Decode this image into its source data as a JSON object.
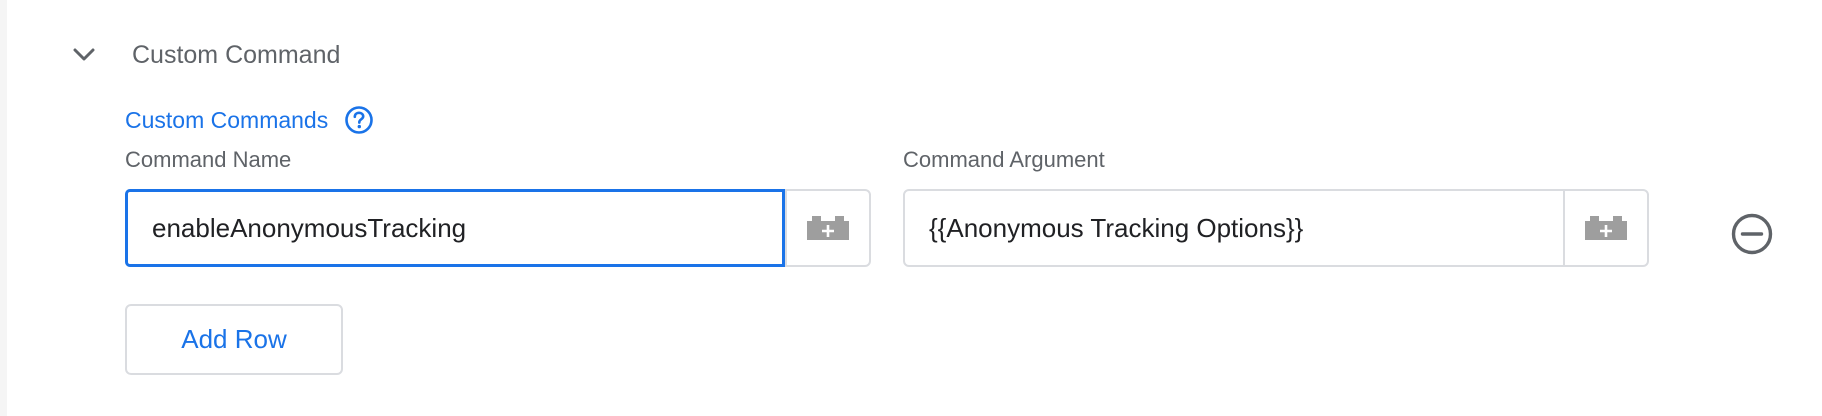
{
  "section": {
    "title": "Custom Command",
    "expanded_icon": "chevron-down-icon"
  },
  "custom_commands": {
    "label": "Custom Commands",
    "help_icon": "help-circle-icon"
  },
  "table": {
    "columns": [
      "Command Name",
      "Command Argument"
    ],
    "rows": [
      {
        "command_name": "enableAnonymousTracking",
        "command_argument": "{{Anonymous Tracking Options}}",
        "variable_icon": "lego-block-plus-icon",
        "remove_icon": "minus-circle-icon"
      }
    ]
  },
  "actions": {
    "add_row_label": "Add Row"
  },
  "colors": {
    "accent": "#1a73e8",
    "text_secondary": "#5f6368",
    "border": "#dadce0",
    "icon_gray": "#9e9e9e"
  }
}
